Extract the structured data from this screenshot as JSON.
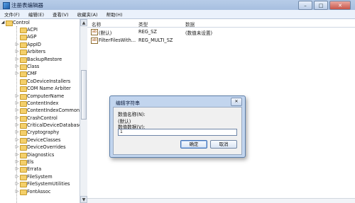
{
  "window": {
    "title": "注册表编辑器",
    "minimize": "–",
    "maximize": "□",
    "close": "✕"
  },
  "menu": [
    "文件(F)",
    "编辑(E)",
    "查看(V)",
    "收藏夹(A)",
    "帮助(H)"
  ],
  "tree": {
    "root": "Control",
    "items": [
      {
        "label": "ACPI",
        "expandable": false
      },
      {
        "label": "AGP",
        "expandable": false
      },
      {
        "label": "AppID",
        "expandable": true
      },
      {
        "label": "Arbiters",
        "expandable": true
      },
      {
        "label": "BackupRestore",
        "expandable": true
      },
      {
        "label": "Class",
        "expandable": true
      },
      {
        "label": "CMF",
        "expandable": true
      },
      {
        "label": "CoDeviceInstallers",
        "expandable": false
      },
      {
        "label": "COM Name Arbiter",
        "expandable": false
      },
      {
        "label": "ComputerName",
        "expandable": true
      },
      {
        "label": "ContentIndex",
        "expandable": true
      },
      {
        "label": "ContentIndexCommon",
        "expandable": true
      },
      {
        "label": "CrashControl",
        "expandable": true
      },
      {
        "label": "CriticalDeviceDatabase",
        "expandable": true
      },
      {
        "label": "Cryptography",
        "expandable": true
      },
      {
        "label": "DeviceClasses",
        "expandable": true
      },
      {
        "label": "DeviceOverrides",
        "expandable": true
      },
      {
        "label": "Diagnostics",
        "expandable": true
      },
      {
        "label": "Els",
        "expandable": true
      },
      {
        "label": "Errata",
        "expandable": true
      },
      {
        "label": "FileSystem",
        "expandable": true
      },
      {
        "label": "FileSystemUtilities",
        "expandable": true
      },
      {
        "label": "FontAssoc",
        "expandable": true
      }
    ]
  },
  "list": {
    "headers": [
      "名称",
      "类型",
      "数据"
    ],
    "rows": [
      {
        "icon": "ab",
        "name": "(默认)",
        "type": "REG_SZ",
        "data": "(数值未设置)"
      },
      {
        "icon": "ab",
        "name": "FilterFilesWith...",
        "type": "REG_MULTI_SZ",
        "data": ""
      }
    ]
  },
  "dialog": {
    "title": "编辑字符串",
    "close": "✕",
    "name_label": "数值名称(N):",
    "name_value": "(默认)",
    "data_label": "数值数据(V):",
    "data_value": "1",
    "ok": "确定",
    "cancel": "取消"
  }
}
